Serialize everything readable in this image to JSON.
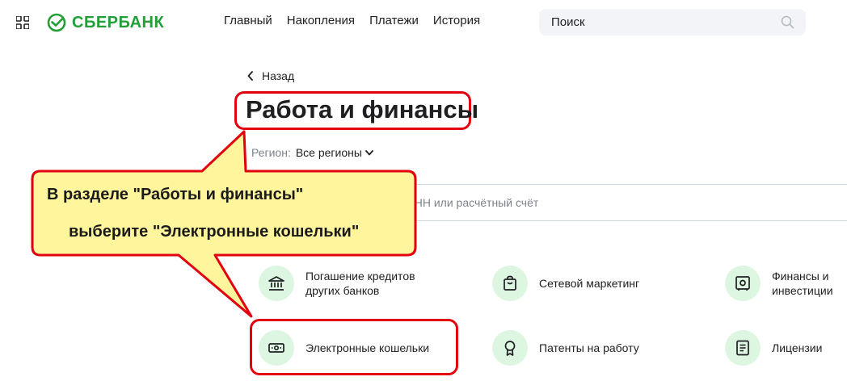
{
  "brand": {
    "name": "СБЕРБАНК",
    "color": "#21a038"
  },
  "nav": [
    "Главный",
    "Накопления",
    "Платежи",
    "История"
  ],
  "search": {
    "placeholder": "Поиск"
  },
  "back_label": "Назад",
  "page_title": "Работа и финансы",
  "region": {
    "label": "Регион:",
    "value": "Все регионы"
  },
  "service_search": {
    "placeholder": "Название, категория услуги, ИНН или расчётный счёт"
  },
  "callout": {
    "line1": "В разделе \"Работы и финансы\"",
    "line2": "выберите \"Электронные кошельки\""
  },
  "categories": [
    {
      "label": "Погашение кредитов\nдругих банков",
      "icon": "bank-icon"
    },
    {
      "label": "Сетевой маркетинг",
      "icon": "shopping-bag-icon"
    },
    {
      "label": "Финансы и инвестиции",
      "icon": "safe-icon"
    },
    {
      "label": "Электронные кошельки",
      "icon": "wallet-icon"
    },
    {
      "label": "Патенты на работу",
      "icon": "award-icon"
    },
    {
      "label": "Лицензии",
      "icon": "document-icon"
    }
  ],
  "colors": {
    "accent": "#21a038",
    "highlight": "#e3000f",
    "callout_fill": "#fff59d",
    "icon_bg": "#ddf6e2"
  }
}
